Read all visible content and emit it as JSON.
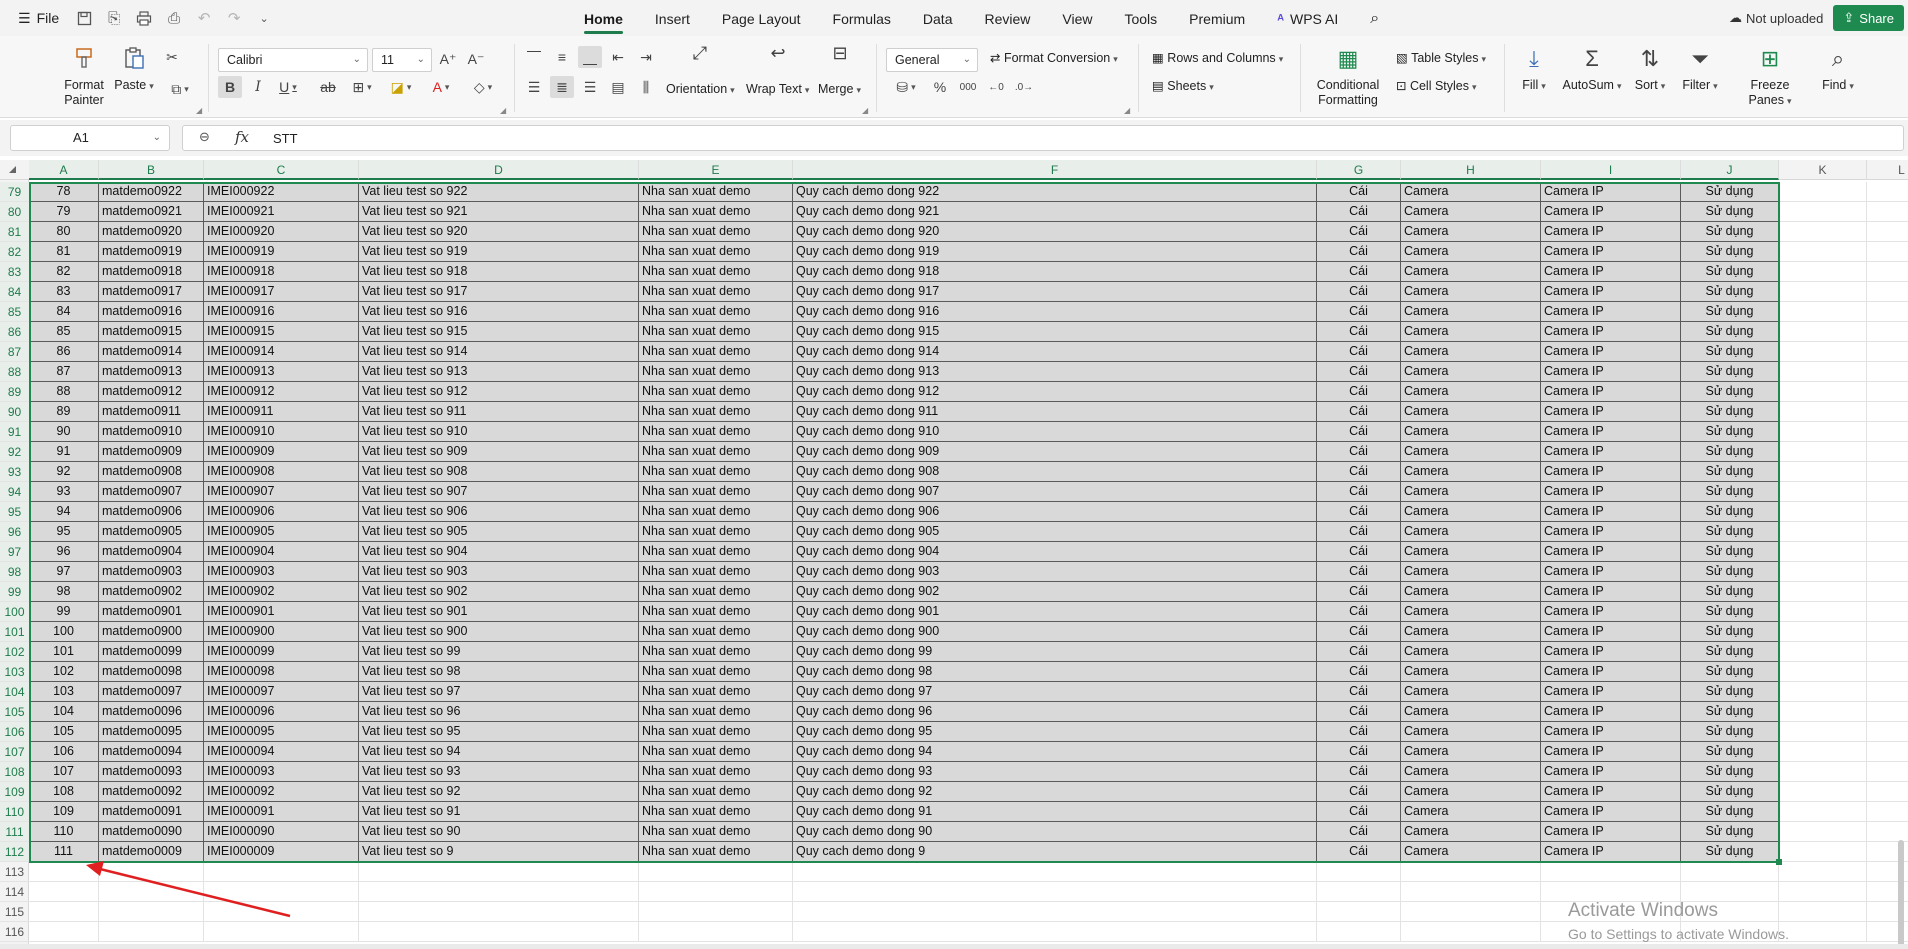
{
  "menubar": {
    "file_label": "File",
    "tabs": [
      "Home",
      "Insert",
      "Page Layout",
      "Formulas",
      "Data",
      "Review",
      "View",
      "Tools",
      "Premium",
      "WPS AI"
    ],
    "active_tab": "Home",
    "status": "Not uploaded",
    "share_label": "Share"
  },
  "ribbon": {
    "format_painter": "Format Painter",
    "paste": "Paste",
    "font_name": "Calibri",
    "font_size": "11",
    "orientation": "Orientation",
    "wrap_text": "Wrap Text",
    "merge": "Merge",
    "number_format": "General",
    "format_conversion": "Format Conversion",
    "percent": "%",
    "rows_columns": "Rows and Columns",
    "sheets": "Sheets",
    "conditional_formatting": "Conditional Formatting",
    "table_styles": "Table Styles",
    "cell_styles": "Cell Styles",
    "fill": "Fill",
    "autosum": "AutoSum",
    "sort": "Sort",
    "filter": "Filter",
    "freeze_panes": "Freeze Panes",
    "find": "Find",
    "bold": "B",
    "italic": "I",
    "underline": "U"
  },
  "formula_bar": {
    "cell_ref": "A1",
    "fx": "fx",
    "value": "STT"
  },
  "columns": [
    "A",
    "B",
    "C",
    "D",
    "E",
    "F",
    "G",
    "H",
    "I",
    "J",
    "K",
    "L"
  ],
  "rows": [
    {
      "n": "79",
      "cells": [
        "78",
        "matdemo0922",
        "IMEI000922",
        "Vat lieu test so 922",
        "Nha san xuat demo",
        "Quy cach demo dong 922",
        "Cái",
        "Camera",
        "Camera IP",
        "Sử dụng"
      ]
    },
    {
      "n": "80",
      "cells": [
        "79",
        "matdemo0921",
        "IMEI000921",
        "Vat lieu test so 921",
        "Nha san xuat demo",
        "Quy cach demo dong 921",
        "Cái",
        "Camera",
        "Camera IP",
        "Sử dụng"
      ]
    },
    {
      "n": "81",
      "cells": [
        "80",
        "matdemo0920",
        "IMEI000920",
        "Vat lieu test so 920",
        "Nha san xuat demo",
        "Quy cach demo dong 920",
        "Cái",
        "Camera",
        "Camera IP",
        "Sử dụng"
      ]
    },
    {
      "n": "82",
      "cells": [
        "81",
        "matdemo0919",
        "IMEI000919",
        "Vat lieu test so 919",
        "Nha san xuat demo",
        "Quy cach demo dong 919",
        "Cái",
        "Camera",
        "Camera IP",
        "Sử dụng"
      ]
    },
    {
      "n": "83",
      "cells": [
        "82",
        "matdemo0918",
        "IMEI000918",
        "Vat lieu test so 918",
        "Nha san xuat demo",
        "Quy cach demo dong 918",
        "Cái",
        "Camera",
        "Camera IP",
        "Sử dụng"
      ]
    },
    {
      "n": "84",
      "cells": [
        "83",
        "matdemo0917",
        "IMEI000917",
        "Vat lieu test so 917",
        "Nha san xuat demo",
        "Quy cach demo dong 917",
        "Cái",
        "Camera",
        "Camera IP",
        "Sử dụng"
      ]
    },
    {
      "n": "85",
      "cells": [
        "84",
        "matdemo0916",
        "IMEI000916",
        "Vat lieu test so 916",
        "Nha san xuat demo",
        "Quy cach demo dong 916",
        "Cái",
        "Camera",
        "Camera IP",
        "Sử dụng"
      ]
    },
    {
      "n": "86",
      "cells": [
        "85",
        "matdemo0915",
        "IMEI000915",
        "Vat lieu test so 915",
        "Nha san xuat demo",
        "Quy cach demo dong 915",
        "Cái",
        "Camera",
        "Camera IP",
        "Sử dụng"
      ]
    },
    {
      "n": "87",
      "cells": [
        "86",
        "matdemo0914",
        "IMEI000914",
        "Vat lieu test so 914",
        "Nha san xuat demo",
        "Quy cach demo dong 914",
        "Cái",
        "Camera",
        "Camera IP",
        "Sử dụng"
      ]
    },
    {
      "n": "88",
      "cells": [
        "87",
        "matdemo0913",
        "IMEI000913",
        "Vat lieu test so 913",
        "Nha san xuat demo",
        "Quy cach demo dong 913",
        "Cái",
        "Camera",
        "Camera IP",
        "Sử dụng"
      ]
    },
    {
      "n": "89",
      "cells": [
        "88",
        "matdemo0912",
        "IMEI000912",
        "Vat lieu test so 912",
        "Nha san xuat demo",
        "Quy cach demo dong 912",
        "Cái",
        "Camera",
        "Camera IP",
        "Sử dụng"
      ]
    },
    {
      "n": "90",
      "cells": [
        "89",
        "matdemo0911",
        "IMEI000911",
        "Vat lieu test so 911",
        "Nha san xuat demo",
        "Quy cach demo dong 911",
        "Cái",
        "Camera",
        "Camera IP",
        "Sử dụng"
      ]
    },
    {
      "n": "91",
      "cells": [
        "90",
        "matdemo0910",
        "IMEI000910",
        "Vat lieu test so 910",
        "Nha san xuat demo",
        "Quy cach demo dong 910",
        "Cái",
        "Camera",
        "Camera IP",
        "Sử dụng"
      ]
    },
    {
      "n": "92",
      "cells": [
        "91",
        "matdemo0909",
        "IMEI000909",
        "Vat lieu test so 909",
        "Nha san xuat demo",
        "Quy cach demo dong 909",
        "Cái",
        "Camera",
        "Camera IP",
        "Sử dụng"
      ]
    },
    {
      "n": "93",
      "cells": [
        "92",
        "matdemo0908",
        "IMEI000908",
        "Vat lieu test so 908",
        "Nha san xuat demo",
        "Quy cach demo dong 908",
        "Cái",
        "Camera",
        "Camera IP",
        "Sử dụng"
      ]
    },
    {
      "n": "94",
      "cells": [
        "93",
        "matdemo0907",
        "IMEI000907",
        "Vat lieu test so 907",
        "Nha san xuat demo",
        "Quy cach demo dong 907",
        "Cái",
        "Camera",
        "Camera IP",
        "Sử dụng"
      ]
    },
    {
      "n": "95",
      "cells": [
        "94",
        "matdemo0906",
        "IMEI000906",
        "Vat lieu test so 906",
        "Nha san xuat demo",
        "Quy cach demo dong 906",
        "Cái",
        "Camera",
        "Camera IP",
        "Sử dụng"
      ]
    },
    {
      "n": "96",
      "cells": [
        "95",
        "matdemo0905",
        "IMEI000905",
        "Vat lieu test so 905",
        "Nha san xuat demo",
        "Quy cach demo dong 905",
        "Cái",
        "Camera",
        "Camera IP",
        "Sử dụng"
      ]
    },
    {
      "n": "97",
      "cells": [
        "96",
        "matdemo0904",
        "IMEI000904",
        "Vat lieu test so 904",
        "Nha san xuat demo",
        "Quy cach demo dong 904",
        "Cái",
        "Camera",
        "Camera IP",
        "Sử dụng"
      ]
    },
    {
      "n": "98",
      "cells": [
        "97",
        "matdemo0903",
        "IMEI000903",
        "Vat lieu test so 903",
        "Nha san xuat demo",
        "Quy cach demo dong 903",
        "Cái",
        "Camera",
        "Camera IP",
        "Sử dụng"
      ]
    },
    {
      "n": "99",
      "cells": [
        "98",
        "matdemo0902",
        "IMEI000902",
        "Vat lieu test so 902",
        "Nha san xuat demo",
        "Quy cach demo dong 902",
        "Cái",
        "Camera",
        "Camera IP",
        "Sử dụng"
      ]
    },
    {
      "n": "100",
      "cells": [
        "99",
        "matdemo0901",
        "IMEI000901",
        "Vat lieu test so 901",
        "Nha san xuat demo",
        "Quy cach demo dong 901",
        "Cái",
        "Camera",
        "Camera IP",
        "Sử dụng"
      ]
    },
    {
      "n": "101",
      "cells": [
        "100",
        "matdemo0900",
        "IMEI000900",
        "Vat lieu test so 900",
        "Nha san xuat demo",
        "Quy cach demo dong 900",
        "Cái",
        "Camera",
        "Camera IP",
        "Sử dụng"
      ]
    },
    {
      "n": "102",
      "cells": [
        "101",
        "matdemo0099",
        "IMEI000099",
        "Vat lieu test so 99",
        "Nha san xuat demo",
        "Quy cach demo dong 99",
        "Cái",
        "Camera",
        "Camera IP",
        "Sử dụng"
      ]
    },
    {
      "n": "103",
      "cells": [
        "102",
        "matdemo0098",
        "IMEI000098",
        "Vat lieu test so 98",
        "Nha san xuat demo",
        "Quy cach demo dong 98",
        "Cái",
        "Camera",
        "Camera IP",
        "Sử dụng"
      ]
    },
    {
      "n": "104",
      "cells": [
        "103",
        "matdemo0097",
        "IMEI000097",
        "Vat lieu test so 97",
        "Nha san xuat demo",
        "Quy cach demo dong 97",
        "Cái",
        "Camera",
        "Camera IP",
        "Sử dụng"
      ]
    },
    {
      "n": "105",
      "cells": [
        "104",
        "matdemo0096",
        "IMEI000096",
        "Vat lieu test so 96",
        "Nha san xuat demo",
        "Quy cach demo dong 96",
        "Cái",
        "Camera",
        "Camera IP",
        "Sử dụng"
      ]
    },
    {
      "n": "106",
      "cells": [
        "105",
        "matdemo0095",
        "IMEI000095",
        "Vat lieu test so 95",
        "Nha san xuat demo",
        "Quy cach demo dong 95",
        "Cái",
        "Camera",
        "Camera IP",
        "Sử dụng"
      ]
    },
    {
      "n": "107",
      "cells": [
        "106",
        "matdemo0094",
        "IMEI000094",
        "Vat lieu test so 94",
        "Nha san xuat demo",
        "Quy cach demo dong 94",
        "Cái",
        "Camera",
        "Camera IP",
        "Sử dụng"
      ]
    },
    {
      "n": "108",
      "cells": [
        "107",
        "matdemo0093",
        "IMEI000093",
        "Vat lieu test so 93",
        "Nha san xuat demo",
        "Quy cach demo dong 93",
        "Cái",
        "Camera",
        "Camera IP",
        "Sử dụng"
      ]
    },
    {
      "n": "109",
      "cells": [
        "108",
        "matdemo0092",
        "IMEI000092",
        "Vat lieu test so 92",
        "Nha san xuat demo",
        "Quy cach demo dong 92",
        "Cái",
        "Camera",
        "Camera IP",
        "Sử dụng"
      ]
    },
    {
      "n": "110",
      "cells": [
        "109",
        "matdemo0091",
        "IMEI000091",
        "Vat lieu test so 91",
        "Nha san xuat demo",
        "Quy cach demo dong 91",
        "Cái",
        "Camera",
        "Camera IP",
        "Sử dụng"
      ]
    },
    {
      "n": "111",
      "cells": [
        "110",
        "matdemo0090",
        "IMEI000090",
        "Vat lieu test so 90",
        "Nha san xuat demo",
        "Quy cach demo dong 90",
        "Cái",
        "Camera",
        "Camera IP",
        "Sử dụng"
      ]
    },
    {
      "n": "112",
      "cells": [
        "111",
        "matdemo0009",
        "IMEI000009",
        "Vat lieu test so 9",
        "Nha san xuat demo",
        "Quy cach demo dong 9",
        "Cái",
        "Camera",
        "Camera IP",
        "Sử dụng"
      ]
    }
  ],
  "empty_rows": [
    "113",
    "114",
    "115",
    "116"
  ],
  "watermark": {
    "line1": "Activate Windows",
    "line2": "Go to Settings to activate Windows."
  },
  "colors": {
    "accent": "#1e8a4f",
    "annotation_arrow": "#e02020",
    "data_fill": "#d9d9d9"
  }
}
